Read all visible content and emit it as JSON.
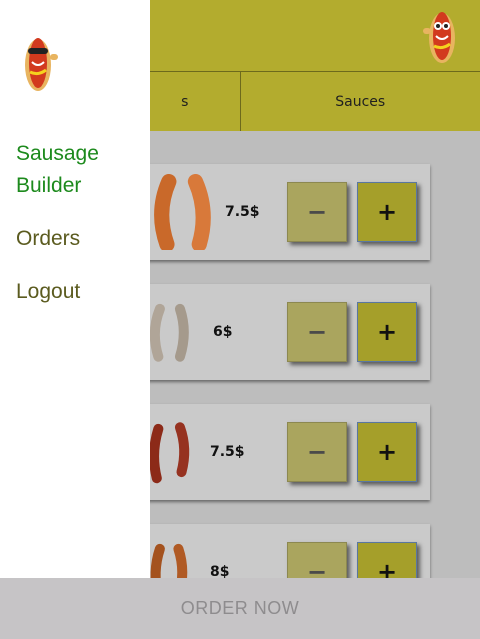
{
  "header": {
    "logo_icon": "hotdog-mascot-icon"
  },
  "tabs": [
    {
      "label": "s"
    },
    {
      "label": "Sauces"
    }
  ],
  "products": [
    {
      "price": "7.5$",
      "color": "#c9692a"
    },
    {
      "price": "6$",
      "color": "#b0a598"
    },
    {
      "price": "7.5$",
      "color": "#8c2a18"
    },
    {
      "price": "8$",
      "color": "#a4521e"
    }
  ],
  "quantity_controls": {
    "minus_label": "−",
    "plus_label": "+"
  },
  "drawer": {
    "logo_icon": "hotdog-mascot-icon",
    "items": [
      {
        "label_line1": "Sausage",
        "label_line2": "Builder",
        "color": "#1d8a1d"
      },
      {
        "label": "Orders",
        "color": "#5b5b1f"
      },
      {
        "label": "Logout",
        "color": "#5b5b1f"
      }
    ]
  },
  "footer": {
    "order_label": "ORDER NOW"
  },
  "colors": {
    "accent": "#b3ac2e",
    "drawer_bg": "#ffffff",
    "active_nav": "#1d8a1d"
  }
}
